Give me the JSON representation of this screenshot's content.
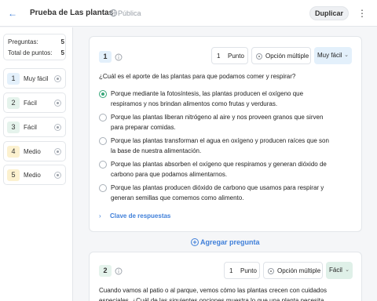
{
  "header": {
    "title": "Prueba de Las plantas",
    "visibility": "Pública",
    "duplicate_label": "Duplicar"
  },
  "sidebar": {
    "questions_label": "Preguntas:",
    "questions_count": "5",
    "points_label": "Total de puntos:",
    "points_count": "5",
    "items": [
      {
        "num": "1",
        "label": "Muy fácil"
      },
      {
        "num": "2",
        "label": "Fácil"
      },
      {
        "num": "3",
        "label": "Fácil"
      },
      {
        "num": "4",
        "label": "Medio"
      },
      {
        "num": "5",
        "label": "Medio"
      }
    ]
  },
  "q1": {
    "num": "1",
    "points": "1",
    "points_label": "Punto",
    "type": "Opción múltiple",
    "difficulty": "Muy fácil",
    "text": "¿Cuál es el aporte de las plantas para que podamos comer y respirar?",
    "answers": [
      "Porque mediante la fotosíntesis, las plantas producen el oxígeno que respiramos y nos brindan alimentos como frutas y verduras.",
      "Porque las plantas liberan nitrógeno al aire y nos proveen granos que sirven para preparar comidas.",
      "Porque las plantas transforman el agua en oxígeno y producen raíces que son la base de nuestra alimentación.",
      "Porque las plantas absorben el oxígeno que respiramos y generan dióxido de carbono para que podamos alimentarnos.",
      "Porque las plantas producen dióxido de carbono que usamos para respirar y generan semillas que comemos como alimento."
    ],
    "key_label": "Clave de respuestas"
  },
  "add_question_label": "Agregar pregunta",
  "q2": {
    "num": "2",
    "points": "1",
    "points_label": "Punto",
    "type": "Opción múltiple",
    "difficulty": "Fácil",
    "text": "Cuando vamos al patio o al parque, vemos cómo las plantas crecen con cuidados especiales. ¿Cuál de las siguientes opciones muestra lo que una planta necesita para"
  }
}
